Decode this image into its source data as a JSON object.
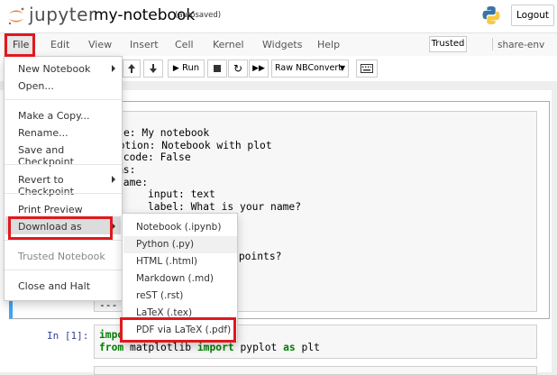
{
  "header": {
    "logo_text": "jupyter",
    "notebook_name": "my-notebook",
    "autosave_status": "(autosaved)",
    "logout_label": "Logout"
  },
  "menubar": {
    "items": [
      "File",
      "Edit",
      "View",
      "Insert",
      "Cell",
      "Kernel",
      "Widgets",
      "Help"
    ],
    "trusted_label": "Trusted",
    "kernel_name": "share-env"
  },
  "toolbar": {
    "run_label": "Run",
    "cell_type": "Raw NBConvert"
  },
  "file_menu": {
    "items": [
      {
        "label": "New Notebook",
        "submenu": true
      },
      {
        "label": "Open..."
      },
      {
        "label": "Make a Copy..."
      },
      {
        "label": "Rename..."
      },
      {
        "label": "Save and Checkpoint"
      },
      {
        "label": "Revert to Checkpoint",
        "submenu": true
      },
      {
        "label": "Print Preview"
      },
      {
        "label": "Download as",
        "submenu": true
      },
      {
        "label": "Trusted Notebook"
      },
      {
        "label": "Close and Halt"
      }
    ]
  },
  "download_menu": {
    "items": [
      "Notebook (.ipynb)",
      "Python (.py)",
      "HTML (.html)",
      "Markdown (.md)",
      "reST (.rst)",
      "LaTeX (.tex)",
      "PDF via LaTeX (.pdf)"
    ]
  },
  "cells": {
    "raw_lines": [
      "e: My notebook",
      "ription: Notebook with plot",
      "-code: False",
      "ms:",
      "name:",
      "     input: text",
      "     label: What is your name?",
      "           points?",
      "---"
    ],
    "code_prompt": "In [1]:",
    "code_line1_kw": "impo",
    "code_line2_from": "from",
    "code_line2_mod": "matplotlib",
    "code_line2_import": "import",
    "code_line2_name": "pyplot",
    "code_line2_as": "as",
    "code_line2_alias": "plt"
  },
  "colors": {
    "highlight_box": "#e0181f",
    "selected_cell_border": "#42a5f5"
  }
}
